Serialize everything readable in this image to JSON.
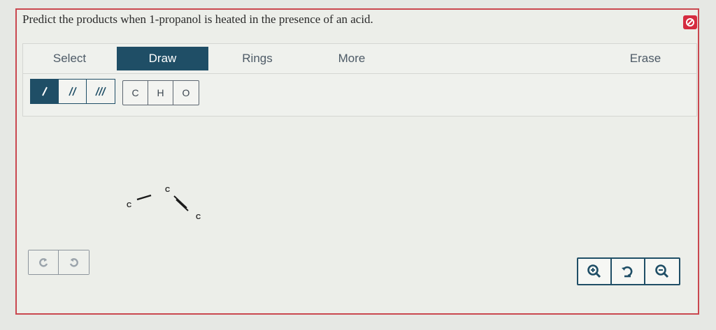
{
  "question": {
    "text": "Predict the products when 1-propanol is heated in the presence of an acid."
  },
  "toolbar": {
    "tabs": [
      {
        "label": "Select"
      },
      {
        "label": "Draw"
      },
      {
        "label": "Rings"
      },
      {
        "label": "More"
      },
      {
        "label": "Erase"
      }
    ],
    "active_tab": "Draw",
    "bond_tools": [
      "single-bond-icon",
      "double-bond-icon",
      "triple-bond-icon"
    ],
    "atoms": [
      "C",
      "H",
      "O"
    ]
  },
  "molecule": {
    "atoms": [
      "C",
      "C",
      "C"
    ]
  },
  "history": {
    "icons": [
      "undo-icon",
      "redo-icon"
    ]
  },
  "zoom": {
    "icons": [
      "zoom-in-icon",
      "reset-view-icon",
      "zoom-out-icon"
    ]
  },
  "colors": {
    "accent": "#1f4e66",
    "border": "#c9474f",
    "alert": "#d52b3f"
  }
}
